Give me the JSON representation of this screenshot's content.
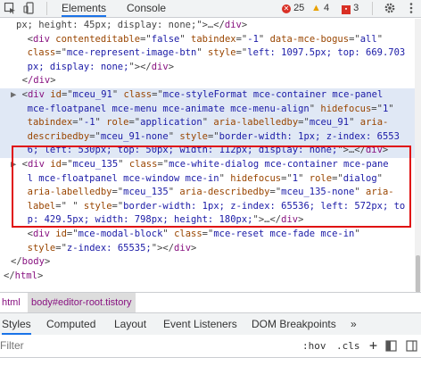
{
  "toolbar": {
    "tabs": [
      "Elements",
      "Console"
    ],
    "errors": "25",
    "warnings": "4",
    "issues": "3"
  },
  "code_lines": [
    [
      [
        "p",
        "px; height: 45px; display: none;\">…</"
      ],
      [
        "t",
        "div"
      ],
      [
        "p",
        ">"
      ]
    ],
    [
      [
        "p",
        "  <"
      ],
      [
        "t",
        "div "
      ],
      [
        "a",
        "contenteditable"
      ],
      [
        "p",
        "=\""
      ],
      [
        "v",
        "false"
      ],
      [
        "p",
        "\" "
      ],
      [
        "a",
        "tabindex"
      ],
      [
        "p",
        "=\""
      ],
      [
        "v",
        "-1"
      ],
      [
        "p",
        "\" "
      ],
      [
        "a",
        "data-mce-bogus"
      ],
      [
        "p",
        "=\""
      ],
      [
        "v",
        "all"
      ],
      [
        "p",
        "\""
      ]
    ],
    [
      [
        "a",
        "  class"
      ],
      [
        "p",
        "=\""
      ],
      [
        "v",
        "mce-represent-image-btn"
      ],
      [
        "p",
        "\" "
      ],
      [
        "a",
        "style"
      ],
      [
        "p",
        "=\""
      ],
      [
        "v",
        "left: 1097.5px; top: 669.703"
      ]
    ],
    [
      [
        "v",
        "  px; display: none;"
      ],
      [
        "p",
        "\"></"
      ],
      [
        "t",
        "div"
      ],
      [
        "p",
        ">"
      ]
    ],
    [
      [
        "p",
        "  <"
      ],
      [
        "t",
        "/div"
      ],
      [
        "p",
        ">"
      ]
    ],
    [
      [
        "tri",
        "▶ "
      ],
      [
        "p",
        "<"
      ],
      [
        "t",
        "div "
      ],
      [
        "a",
        "id"
      ],
      [
        "p",
        "=\""
      ],
      [
        "v",
        "mceu_91"
      ],
      [
        "p",
        "\" "
      ],
      [
        "a",
        "class"
      ],
      [
        "p",
        "=\""
      ],
      [
        "v",
        "mce-styleFormat mce-container mce-panel"
      ]
    ],
    [
      [
        "v",
        "  mce-floatpanel mce-menu mce-animate mce-menu-align"
      ],
      [
        "p",
        "\" "
      ],
      [
        "a",
        "hidefocus"
      ],
      [
        "p",
        "=\""
      ],
      [
        "v",
        "1"
      ],
      [
        "p",
        "\""
      ]
    ],
    [
      [
        "a",
        "  tabindex"
      ],
      [
        "p",
        "=\""
      ],
      [
        "v",
        "-1"
      ],
      [
        "p",
        "\" "
      ],
      [
        "a",
        "role"
      ],
      [
        "p",
        "=\""
      ],
      [
        "v",
        "application"
      ],
      [
        "p",
        "\" "
      ],
      [
        "a",
        "aria-labelledby"
      ],
      [
        "p",
        "=\""
      ],
      [
        "v",
        "mceu_91"
      ],
      [
        "p",
        "\" "
      ],
      [
        "a",
        "aria-"
      ]
    ],
    [
      [
        "a",
        "  describedby"
      ],
      [
        "p",
        "=\""
      ],
      [
        "v",
        "mceu_91-none"
      ],
      [
        "p",
        "\" "
      ],
      [
        "a",
        "style"
      ],
      [
        "p",
        "=\""
      ],
      [
        "v",
        "border-width: 1px; z-index: 6553"
      ]
    ],
    [
      [
        "v",
        "  6; left: 530px; top: 50px; width: 112px; display: none;"
      ],
      [
        "p",
        "\">…</"
      ],
      [
        "t",
        "div"
      ],
      [
        "p",
        ">"
      ]
    ],
    [
      [
        "tri",
        "▶ "
      ],
      [
        "p",
        "<"
      ],
      [
        "t",
        "div "
      ],
      [
        "a",
        "id"
      ],
      [
        "p",
        "=\""
      ],
      [
        "v",
        "mceu_135"
      ],
      [
        "p",
        "\" "
      ],
      [
        "a",
        "class"
      ],
      [
        "p",
        "=\""
      ],
      [
        "v",
        "mce-white-dialog mce-container mce-pane"
      ]
    ],
    [
      [
        "v",
        "  l mce-floatpanel mce-window mce-in"
      ],
      [
        "p",
        "\" "
      ],
      [
        "a",
        "hidefocus"
      ],
      [
        "p",
        "=\""
      ],
      [
        "v",
        "1"
      ],
      [
        "p",
        "\" "
      ],
      [
        "a",
        "role"
      ],
      [
        "p",
        "=\""
      ],
      [
        "v",
        "dialog"
      ],
      [
        "p",
        "\""
      ]
    ],
    [
      [
        "a",
        "  aria-labelledby"
      ],
      [
        "p",
        "=\""
      ],
      [
        "v",
        "mceu_135"
      ],
      [
        "p",
        "\" "
      ],
      [
        "a",
        "aria-describedby"
      ],
      [
        "p",
        "=\""
      ],
      [
        "v",
        "mceu_135-none"
      ],
      [
        "p",
        "\" "
      ],
      [
        "a",
        "aria-"
      ]
    ],
    [
      [
        "a",
        "  label"
      ],
      [
        "p",
        "=\""
      ],
      [
        "v",
        " "
      ],
      [
        "p",
        "\" "
      ],
      [
        "a",
        "style"
      ],
      [
        "p",
        "=\""
      ],
      [
        "v",
        "border-width: 1px; z-index: 65536; left: 572px; to"
      ]
    ],
    [
      [
        "v",
        "  p: 429.5px; width: 798px; height: 180px;"
      ],
      [
        "p",
        "\">…</"
      ],
      [
        "t",
        "div"
      ],
      [
        "p",
        ">"
      ]
    ],
    [
      [
        "p",
        "  <"
      ],
      [
        "t",
        "div "
      ],
      [
        "a",
        "id"
      ],
      [
        "p",
        "=\""
      ],
      [
        "v",
        "mce-modal-block"
      ],
      [
        "p",
        "\" "
      ],
      [
        "a",
        "class"
      ],
      [
        "p",
        "=\""
      ],
      [
        "v",
        "mce-reset mce-fade mce-in"
      ],
      [
        "p",
        "\""
      ]
    ],
    [
      [
        "a",
        "  style"
      ],
      [
        "p",
        "=\""
      ],
      [
        "v",
        "z-index: 65535;"
      ],
      [
        "p",
        "\"></"
      ],
      [
        "t",
        "div"
      ],
      [
        "p",
        ">"
      ]
    ],
    [
      [
        "p",
        "</"
      ],
      [
        "t",
        "body"
      ],
      [
        "p",
        ">"
      ]
    ],
    [
      [
        "p",
        "</"
      ],
      [
        "t",
        "html"
      ],
      [
        "p",
        ">"
      ]
    ]
  ],
  "breadcrumb": [
    "html",
    "body#editor-root.tistory"
  ],
  "styles_tabs": [
    "Styles",
    "Computed",
    "Layout",
    "Event Listeners",
    "DOM Breakpoints",
    "»"
  ],
  "filter": {
    "placeholder": "Filter",
    "hov": ":hov",
    "cls": ".cls",
    "plus": "+"
  }
}
